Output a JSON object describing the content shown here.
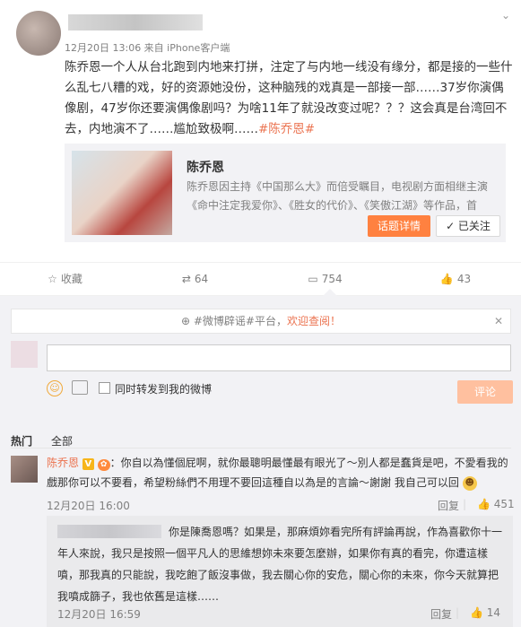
{
  "post": {
    "meta": "12月20日 13:06 来自 iPhone客户端",
    "text": "陈乔恩一个人从台北跑到内地来打拼，注定了与内地一线没有缘分，都是接的一些什么乱七八糟的戏，好的资源她没份，这种脑残的戏真是一部接一部……37岁你演偶像剧，47岁你还要演偶像剧吗？为啥11年了就没改变过呢？？？这会真是台湾回不去，内地演不了……尴尬致极啊……",
    "tag": "#陈乔恩#"
  },
  "card": {
    "title": "陈乔恩",
    "desc": "陈乔恩因主持《中国那么大》而倍受瞩目，电视剧方面相继主演《命中注定我爱你》、《胜女的代价》、《笑傲江湖》等作品，首",
    "topic_button": "话题详情",
    "follow_button": "✓ 已关注"
  },
  "actions": {
    "favorite": "收藏",
    "repost": "64",
    "comment": "754",
    "like": "43"
  },
  "notice": {
    "prefix": "#微博辟谣#平台，",
    "highlight": "欢迎查阅！"
  },
  "composer": {
    "repost_label": "同时转发到我的微博",
    "submit": "评论"
  },
  "filters": {
    "hot": "热门",
    "all": "全部"
  },
  "comment": {
    "user": "陈乔恩",
    "text": "：你自以為懂個屁啊，就你最聰明最懂最有眼光了～別人都是蠢貨是吧，不愛看我的戲那你可以不要看，希望粉絲們不用理不要回這種自以為是的言論～謝謝 我自己可以回",
    "time": "12月20日 16:00",
    "reply": "回复",
    "likes": "451"
  },
  "sub_comment": {
    "text": "你是陳喬恩嗎？如果是，那麻煩妳看完所有評論再說，作為喜歡你十一年人來說，我只是按照一個平凡人的思維想妳未來要怎麼辦，如果你有真的看完，你遭這樣噴，那我真的只能說，我吃飽了飯沒事做，我去關心你的安危，關心你的未來，你今天就算把我噴成篩子，我也依舊是這樣……",
    "time": "12月20日 16:59",
    "reply": "回复",
    "likes": "14"
  },
  "colors": {
    "accent": "#eb7350",
    "button_orange": "#ff8140",
    "bg_gray": "#f2f2f5"
  }
}
